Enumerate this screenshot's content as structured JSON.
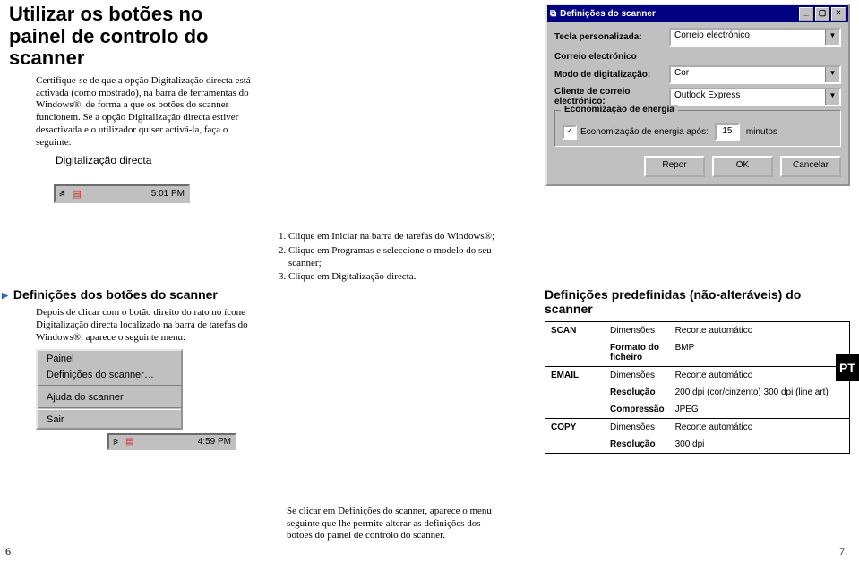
{
  "title": "Utilizar os botões no painel de controlo do scanner",
  "intro": "Certifique-se de que a opção Digitalização directa está activada (como mostrado), na barra de ferramentas do Windows®, de forma a que os botões do scanner funcionem. Se a opção Digitalização directa estiver desactivada e o utilizador quiser activá-la, faça o seguinte:",
  "digitalizacao_label": "Digitalização directa",
  "tray": {
    "clock": "5:01 PM"
  },
  "steps": [
    "Clique em Iniciar na barra de tarefas do Windows®;",
    "Clique em Programas e seleccione o modelo do seu scanner;",
    "Clique em Digitalização directa."
  ],
  "h2_mid": "Definições dos botões do scanner",
  "mid_para": "Depois de clicar com o botão direito do rato no ícone Digitalização directa localizado na barra de tarefas do Windows®, aparece o seguinte menu:",
  "ctxmenu": {
    "item1": "Painel",
    "item2": "Definições do scanner…",
    "item3": "Ajuda do scanner",
    "item4": "Sair"
  },
  "tray2": {
    "clock": "4:59 PM"
  },
  "footer": "Se clicar em Definições do scanner, aparece o menu seguinte que lhe permite alterar as definições dos botões do painel de controlo do scanner.",
  "dialog": {
    "title": "Definições do scanner",
    "label_tecla": "Tecla personalizada:",
    "val_tecla": "Correio electrónico",
    "heading_correio": "Correio electrónico",
    "label_modo": "Modo de digitalização:",
    "val_modo": "Cor",
    "label_cliente": "Cliente de correio electrónico:",
    "val_cliente": "Outlook Express",
    "group_legend": "Economização de energia",
    "checkbox_label": "Economização de energia após:",
    "checkbox_checked": "✓",
    "minutes_value": "15",
    "minutes_word": "minutos",
    "btn_repor": "Repor",
    "btn_ok": "OK",
    "btn_cancel": "Cancelar"
  },
  "h2_right": "Definições predefinidas (não-alteráveis) do scanner",
  "table": {
    "scan_label": "SCAN",
    "dimensoes": "Dimensões",
    "scan_dim_val": "Recorte automático",
    "formato": "Formato do ficheiro",
    "formato_val": "BMP",
    "email_label": "EMAIL",
    "email_dim_val": "Recorte automático",
    "resolucao": "Resolução",
    "email_res_val": "200 dpi (cor/cinzento) 300 dpi (line art)",
    "compressao": "Compressão",
    "compressao_val": "JPEG",
    "copy_label": "COPY",
    "copy_dim_val": "Recorte automático",
    "copy_res_val": "300 dpi"
  },
  "pt_badge": "PT",
  "page_left": "6",
  "page_right": "7"
}
